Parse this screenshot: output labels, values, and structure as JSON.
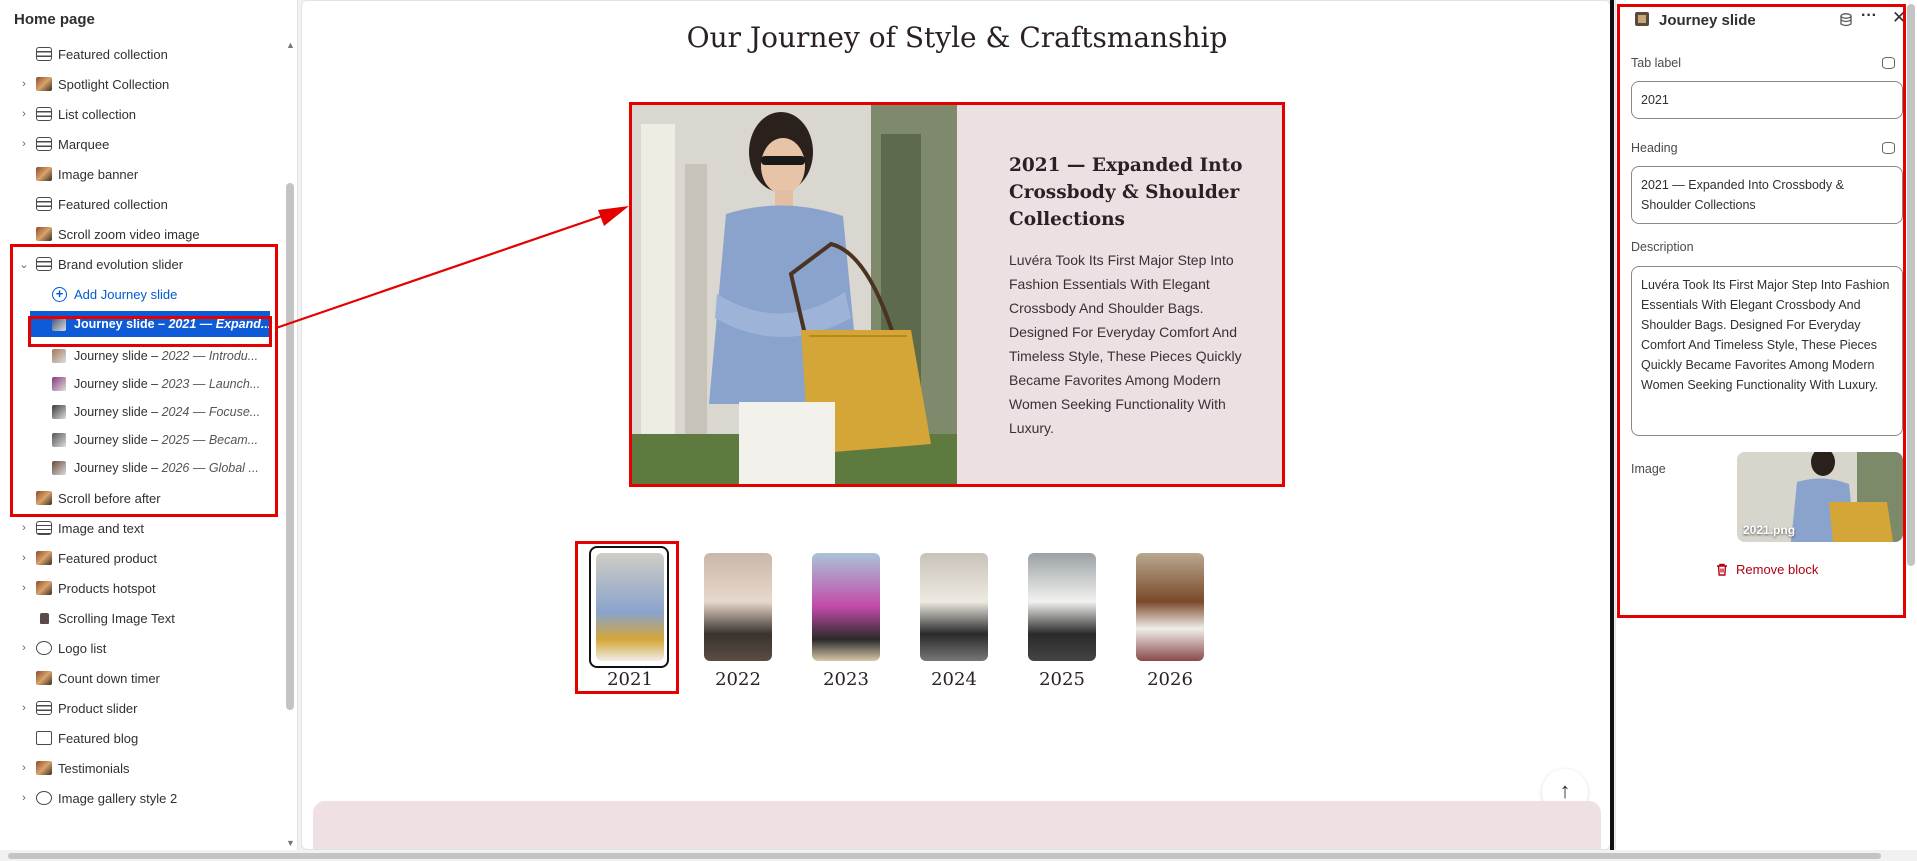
{
  "sidebar": {
    "title": "Home page",
    "items": [
      {
        "label": "Featured collection",
        "icon": "layout-icon",
        "chevron": false
      },
      {
        "label": "Spotlight Collection",
        "icon": "image-icon",
        "chevron": true
      },
      {
        "label": "List collection",
        "icon": "layout-icon",
        "chevron": true
      },
      {
        "label": "Marquee",
        "icon": "layout-icon",
        "chevron": true
      },
      {
        "label": "Image banner",
        "icon": "image-icon",
        "chevron": false
      },
      {
        "label": "Featured collection",
        "icon": "layout-icon",
        "chevron": false
      },
      {
        "label": "Scroll zoom video image",
        "icon": "image-icon",
        "chevron": false
      },
      {
        "label": "Brand evolution slider",
        "icon": "layout-icon",
        "chevron": true,
        "expanded": true
      }
    ],
    "add_block_label": "Add Journey slide",
    "journey_slides": [
      {
        "prefix": "Journey slide – ",
        "title": "2021 — Expand...",
        "selected": true
      },
      {
        "prefix": "Journey slide – ",
        "title": "2022 — Introdu...",
        "selected": false
      },
      {
        "prefix": "Journey slide – ",
        "title": "2023 — Launch...",
        "selected": false
      },
      {
        "prefix": "Journey slide – ",
        "title": "2024 — Focuse...",
        "selected": false
      },
      {
        "prefix": "Journey slide – ",
        "title": "2025 — Becam...",
        "selected": false
      },
      {
        "prefix": "Journey slide – ",
        "title": "2026 — Global ...",
        "selected": false
      }
    ],
    "items_after": [
      {
        "label": "Scroll before after",
        "icon": "image-icon",
        "chevron": false
      },
      {
        "label": "Image and text",
        "icon": "text-icon",
        "chevron": true
      },
      {
        "label": "Featured product",
        "icon": "image-icon",
        "chevron": true
      },
      {
        "label": "Products hotspot",
        "icon": "image-icon",
        "chevron": true
      },
      {
        "label": "Scrolling Image Text",
        "icon": "bag-icon",
        "chevron": false
      },
      {
        "label": "Logo list",
        "icon": "logo-icon",
        "chevron": true
      },
      {
        "label": "Count down timer",
        "icon": "image-icon",
        "chevron": false
      },
      {
        "label": "Product slider",
        "icon": "layout-icon",
        "chevron": true
      },
      {
        "label": "Featured blog",
        "icon": "blog-icon",
        "chevron": false
      },
      {
        "label": "Testimonials",
        "icon": "image-icon",
        "chevron": true
      },
      {
        "label": "Image gallery style 2",
        "icon": "gallery-icon",
        "chevron": true
      }
    ]
  },
  "canvas": {
    "page_title": "Our Journey of Style & Craftsmanship",
    "slide": {
      "heading": "2021 — Expanded Into Crossbody & Shoulder Collections",
      "description": "Luvéra Took Its First Major Step Into Fashion Essentials With Elegant Crossbody And Shoulder Bags. Designed For Everyday Comfort And Timeless Style, These Pieces Quickly Became Favorites Among Modern Women Seeking Functionality With Luxury."
    },
    "years": [
      "2021",
      "2022",
      "2023",
      "2024",
      "2025",
      "2026"
    ],
    "selected_year_index": 0,
    "back_to_top_icon": "arrow-up-icon"
  },
  "panel": {
    "title": "Journey slide",
    "tab_label_label": "Tab label",
    "tab_label_value": "2021",
    "heading_label": "Heading",
    "heading_value": "2021 — Expanded Into Crossbody & Shoulder Collections",
    "description_label": "Description",
    "description_value": "Luvéra Took Its First Major Step Into Fashion Essentials With Elegant Crossbody And Shoulder Bags. Designed For Everyday Comfort And Timeless Style, These Pieces Quickly Became Favorites Among Modern Women Seeking Functionality With Luxury.",
    "image_label": "Image",
    "image_filename": "2021.png",
    "remove_label": "Remove block"
  },
  "colors": {
    "accent_blue": "#0d5bd7",
    "annotation_red": "#e50000",
    "slide_bg": "#ede0e3",
    "danger": "#b20013"
  }
}
